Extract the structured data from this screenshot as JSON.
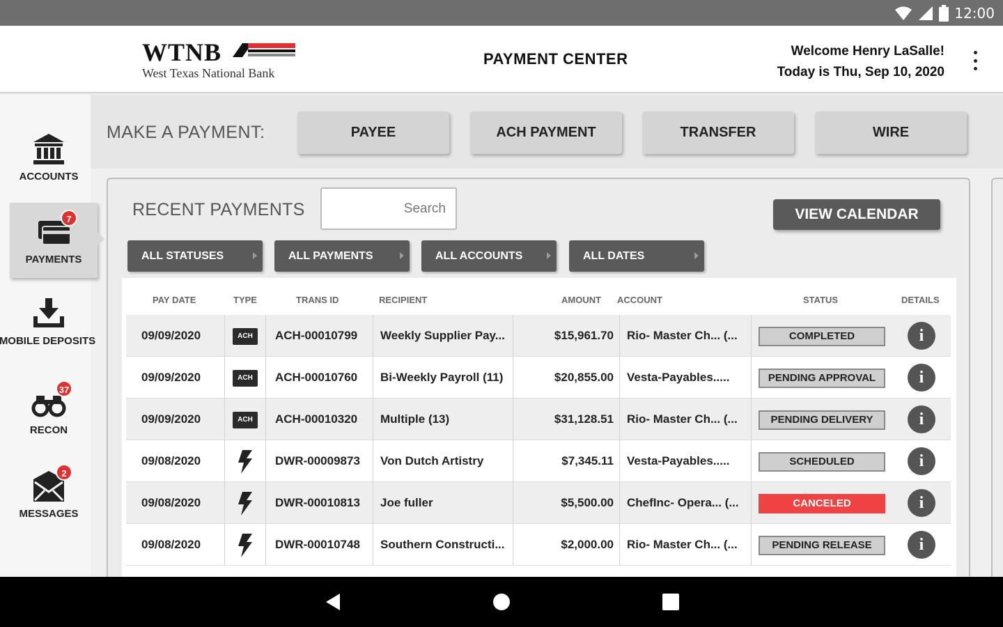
{
  "status_bar": {
    "time": "12:00"
  },
  "header": {
    "logo_text": "WTNB",
    "logo_subtitle": "West Texas National Bank",
    "title": "PAYMENT CENTER",
    "welcome": "Welcome Henry LaSalle!",
    "date_line": "Today is Thu, Sep 10, 2020"
  },
  "sidebar": {
    "items": [
      {
        "label": "ACCOUNTS",
        "badge": ""
      },
      {
        "label": "PAYMENTS",
        "badge": "7"
      },
      {
        "label": "MOBILE DEPOSITS",
        "badge": ""
      },
      {
        "label": "RECON",
        "badge": "37"
      },
      {
        "label": "MESSAGES",
        "badge": "2"
      }
    ]
  },
  "payment_bar": {
    "label": "MAKE A PAYMENT:",
    "buttons": [
      "PAYEE",
      "ACH PAYMENT",
      "TRANSFER",
      "WIRE"
    ]
  },
  "recent": {
    "title": "RECENT PAYMENTS",
    "search_placeholder": "Search",
    "view_calendar": "VIEW CALENDAR",
    "filters": [
      "ALL STATUSES",
      "ALL PAYMENTS",
      "ALL ACCOUNTS",
      "ALL DATES"
    ],
    "columns": [
      "PAY DATE",
      "TYPE",
      "TRANS ID",
      "RECIPIENT",
      "AMOUNT",
      "ACCOUNT",
      "STATUS",
      "DETAILS"
    ],
    "rows": [
      {
        "date": "09/09/2020",
        "type": "ACH",
        "trans_id": "ACH-00010799",
        "recipient": "Weekly Supplier Pay...",
        "amount": "$15,961.70",
        "account": "Rio- Master Ch...  (...",
        "status": "COMPLETED"
      },
      {
        "date": "09/09/2020",
        "type": "ACH",
        "trans_id": "ACH-00010760",
        "recipient": "Bi-Weekly Payroll (11)",
        "amount": "$20,855.00",
        "account": "Vesta-Payables.....",
        "status": "PENDING APPROVAL"
      },
      {
        "date": "09/09/2020",
        "type": "ACH",
        "trans_id": "ACH-00010320",
        "recipient": "Multiple (13)",
        "amount": "$31,128.51",
        "account": "Rio- Master Ch...  (...",
        "status": "PENDING DELIVERY"
      },
      {
        "date": "09/08/2020",
        "type": "WIRE",
        "trans_id": "DWR-00009873",
        "recipient": "Von Dutch Artistry",
        "amount": "$7,345.11",
        "account": "Vesta-Payables.....",
        "status": "SCHEDULED"
      },
      {
        "date": "09/08/2020",
        "type": "WIRE",
        "trans_id": "DWR-00010813",
        "recipient": "Joe fuller",
        "amount": "$5,500.00",
        "account": "ChefInc- Opera...  (...",
        "status": "CANCELED"
      },
      {
        "date": "09/08/2020",
        "type": "WIRE",
        "trans_id": "DWR-00010748",
        "recipient": "Southern Constructi...",
        "amount": "$2,000.00",
        "account": "Rio- Master Ch...  (...",
        "status": "PENDING RELEASE"
      }
    ]
  },
  "colors": {
    "accent_red": "#e03030",
    "cancel_red": "#f04242",
    "dark_button": "#5a5a5a"
  },
  "icons": {
    "type_ach": "ACH",
    "info": "i"
  }
}
